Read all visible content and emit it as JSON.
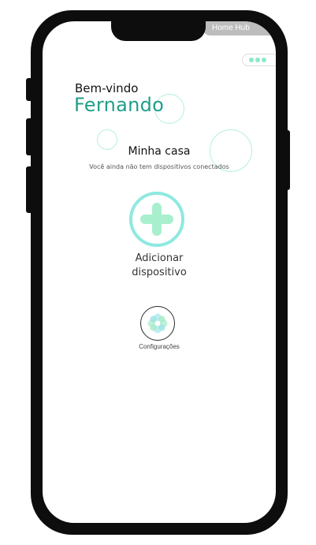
{
  "app": {
    "name": "Home Hub"
  },
  "header": {
    "greeting": "Bem-vindo",
    "user_name": "Fernando",
    "menu_icon": "dots-menu-icon"
  },
  "home": {
    "title": "Minha casa",
    "empty_message": "Você ainda não tem dispositivos conectados"
  },
  "actions": {
    "add_device": {
      "label_line1": "Adicionar",
      "label_line2": "dispositivo",
      "icon": "plus-icon"
    },
    "settings": {
      "label": "Configurações",
      "icon": "flower-gear-icon"
    }
  },
  "colors": {
    "accent": "#1f9e8a",
    "mint": "#8be8c9",
    "ring": "#8fe9e0",
    "frame": "#0d0d0d",
    "pill": "#bdbdbd"
  }
}
